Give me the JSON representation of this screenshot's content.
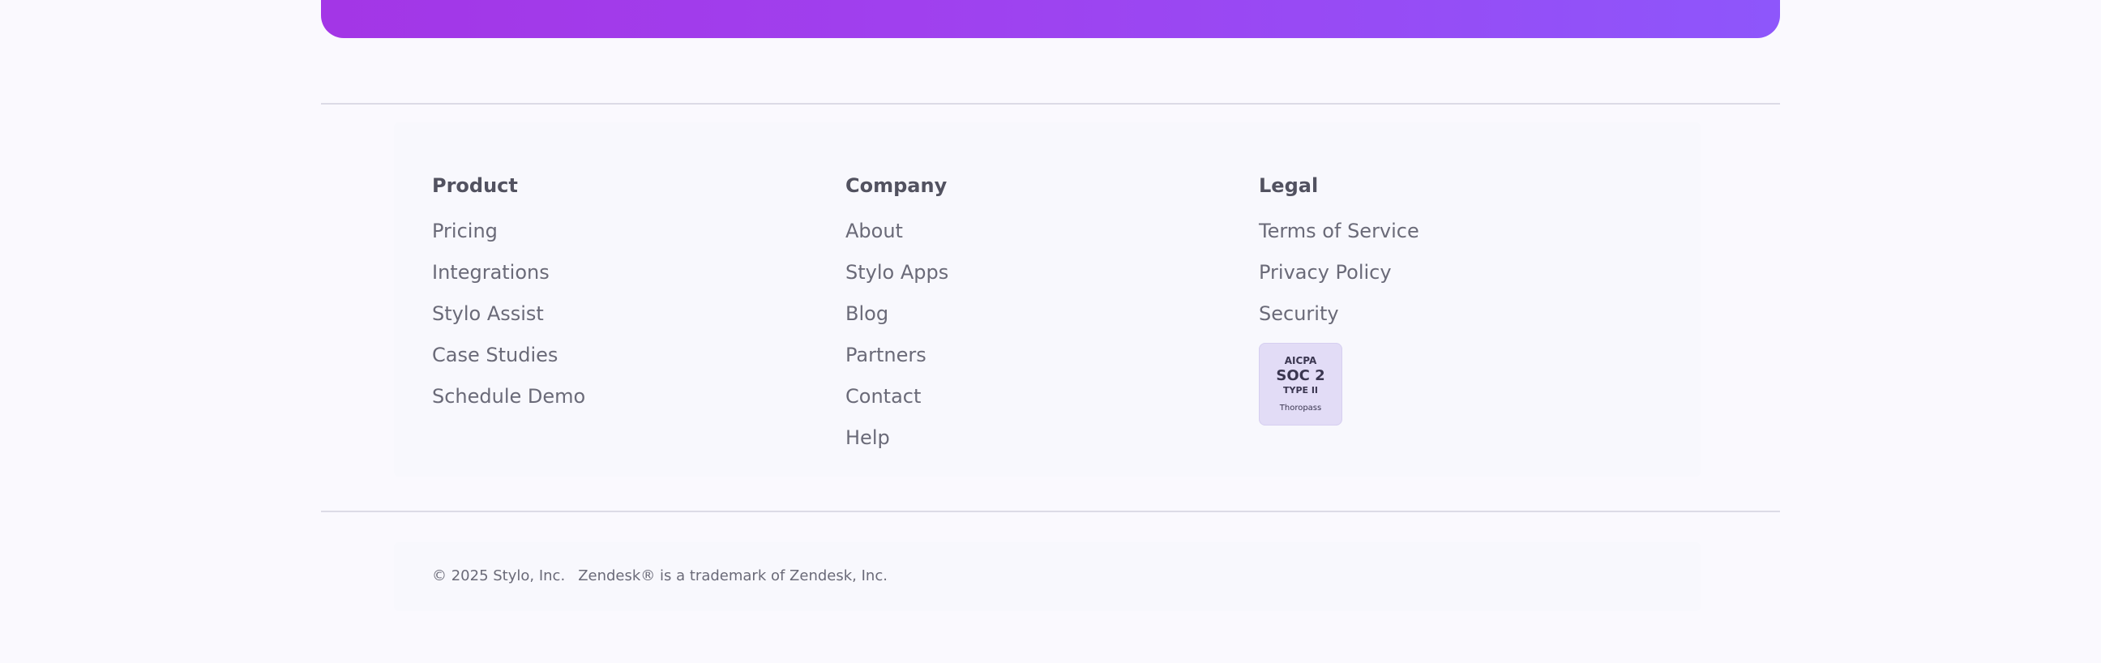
{
  "footer": {
    "columns": {
      "product": {
        "heading": "Product",
        "links": [
          "Pricing",
          "Integrations",
          "Stylo Assist",
          "Case Studies",
          "Schedule Demo"
        ]
      },
      "company": {
        "heading": "Company",
        "links": [
          "About",
          "Stylo Apps",
          "Blog",
          "Partners",
          "Contact",
          "Help"
        ]
      },
      "legal": {
        "heading": "Legal",
        "links": [
          "Terms of Service",
          "Privacy Policy",
          "Security"
        ]
      }
    },
    "badge": {
      "line1": "AICPA",
      "line2": "SOC 2",
      "line3": "TYPE II",
      "line4": "Thoropass"
    },
    "copyright": "© 2025 Stylo, Inc.",
    "trademark": "Zendesk® is a trademark of Zendesk, Inc."
  },
  "colors": {
    "banner_start": "#a336e6",
    "banner_end": "#8e56fb",
    "heading": "#525260",
    "link": "#6a6a78",
    "badge_bg": "#e2dcf6"
  }
}
